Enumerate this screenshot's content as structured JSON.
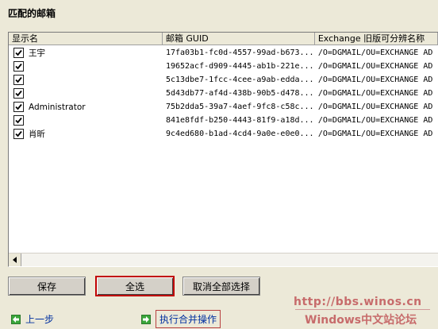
{
  "section_title": "匹配的邮箱",
  "columns": [
    "显示名",
    "邮箱 GUID",
    "Exchange 旧版可分辨名称"
  ],
  "rows": [
    {
      "name": "王宇",
      "guid": "17fa03b1-fc0d-4557-99ad-b673...",
      "dn": "/O=DGMAIL/OU=EXCHANGE AD"
    },
    {
      "name": "",
      "guid": "19652acf-d909-4445-ab1b-221e...",
      "dn": "/O=DGMAIL/OU=EXCHANGE AD"
    },
    {
      "name": "",
      "guid": "5c13dbe7-1fcc-4cee-a9ab-edda...",
      "dn": "/O=DGMAIL/OU=EXCHANGE AD"
    },
    {
      "name": "",
      "guid": "5d43db77-af4d-438b-90b5-d478...",
      "dn": "/O=DGMAIL/OU=EXCHANGE AD"
    },
    {
      "name": "Administrator",
      "guid": "75b2dda5-39a7-4aef-9fc8-c58c...",
      "dn": "/O=DGMAIL/OU=EXCHANGE AD"
    },
    {
      "name": "",
      "guid": "841e8fdf-b250-4443-81f9-a18d...",
      "dn": "/O=DGMAIL/OU=EXCHANGE AD"
    },
    {
      "name": "肖昕",
      "guid": "9c4ed680-b1ad-4cd4-9a0e-e0e0...",
      "dn": "/O=DGMAIL/OU=EXCHANGE AD"
    }
  ],
  "buttons": {
    "save": "保存",
    "select_all": "全选",
    "deselect_all": "取消全部选择"
  },
  "nav": {
    "back": "上一步",
    "execute": "执行合并操作"
  },
  "watermark": {
    "url": "http://bbs.winos.cn",
    "site": "Windows中文站论坛"
  }
}
